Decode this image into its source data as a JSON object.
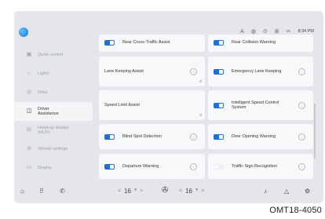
{
  "status": {
    "icons": [
      "A",
      "◍",
      "⊙",
      "⊞",
      "✂"
    ],
    "icon_names": [
      "user-profile-icon",
      "camera-icon",
      "power-icon",
      "display-icon",
      "mute-icon"
    ],
    "time": "8:34 PM"
  },
  "sidebar": {
    "items": [
      {
        "label": "Quick control",
        "icon": "▣"
      },
      {
        "label": "Lights",
        "icon": "☼"
      },
      {
        "label": "Drive",
        "icon": "◎"
      },
      {
        "label": "Driver\nAssistance",
        "icon": "◫"
      },
      {
        "label": "Head-up display\n(HUD)",
        "icon": "⊟"
      },
      {
        "label": "Vehicle settings",
        "icon": "⊖"
      },
      {
        "label": "Display",
        "icon": "▭"
      }
    ]
  },
  "cards": [
    {
      "label": "Rear Cross-Traffic Assist",
      "toggle": "on"
    },
    {
      "label": "Rear Collision Warning",
      "toggle": "on"
    },
    {
      "label": "Lane Keeping Assist",
      "toggle": "none"
    },
    {
      "label": "Emergency Lane Keeping",
      "toggle": "on"
    },
    {
      "label": "Speed Limit Assist",
      "toggle": "none"
    },
    {
      "label": "Intelligent Speed Control\nSystem",
      "toggle": "on"
    },
    {
      "label": "Blind Spot Detection",
      "toggle": "on"
    },
    {
      "label": "Door Opening Warning",
      "toggle": "on"
    },
    {
      "label": "Departure Warning",
      "toggle": "on"
    },
    {
      "label": "Traffic Sign Recognition",
      "toggle": "off"
    }
  ],
  "bottom": {
    "home_icon": "⌂",
    "apps_icon": "⠿",
    "phone_icon": "✆",
    "left_temp": "16",
    "fan_icon": "✇",
    "right_temp": "16",
    "mic_icon": "♪",
    "nav_icon": "△",
    "settings_icon": "⚙",
    "left_arrow": "<",
    "right_arrow": ">",
    "degree": "°"
  },
  "caption": "OMT18-4050",
  "colors": {
    "accent": "#1f6fd6",
    "screen_bg": "#e4e6ea",
    "card_bg": "#f7f8f9"
  }
}
